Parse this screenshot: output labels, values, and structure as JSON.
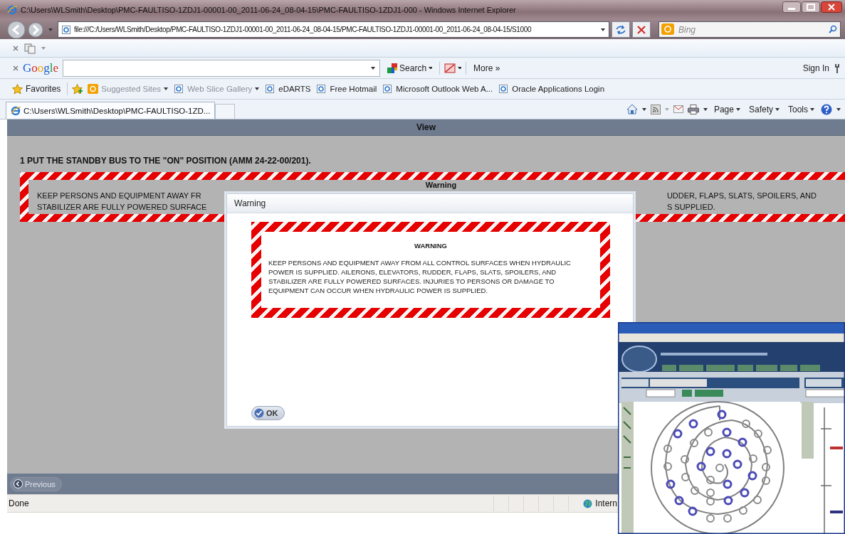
{
  "window": {
    "title": "C:\\Users\\WLSmith\\Desktop\\PMC-FAULTISO-1ZDJ1-00001-00_2011-06-24_08-04-15\\PMC-FAULTISO-1ZDJ1-000 - Windows Internet Explorer"
  },
  "address_bar": {
    "value": "file:///C:/Users/WLSmith/Desktop/PMC-FAULTISO-1ZDJ1-00001-00_2011-06-24_08-04-15/PMC-FAULTISO-1ZDJ1-00001-00_2011-06-24_08-04-15/S1000"
  },
  "search_box": {
    "placeholder": "Bing"
  },
  "google_bar": {
    "logo": "Google",
    "search_label": "Search",
    "more_label": "More »",
    "sign_in": "Sign In"
  },
  "favorites_button": "Favorites",
  "favorites": [
    {
      "label": "Suggested Sites",
      "kind": "feed",
      "dimmed": true,
      "has_menu": true
    },
    {
      "label": "Web Slice Gallery",
      "kind": "page",
      "dimmed": true,
      "has_menu": true
    },
    {
      "label": "eDARTS",
      "kind": "page",
      "dimmed": false,
      "has_menu": false
    },
    {
      "label": "Free Hotmail",
      "kind": "page",
      "dimmed": false,
      "has_menu": false
    },
    {
      "label": "Microsoft Outlook Web A...",
      "kind": "page",
      "dimmed": false,
      "has_menu": false
    },
    {
      "label": "Oracle Applications Login",
      "kind": "page",
      "dimmed": false,
      "has_menu": false
    }
  ],
  "tabs": [
    {
      "label": "C:\\Users\\WLSmith\\Desktop\\PMC-FAULTISO-1ZD...",
      "selected": true
    }
  ],
  "command_bar": [
    {
      "label": "Page"
    },
    {
      "label": "Safety"
    },
    {
      "label": "Tools"
    }
  ],
  "page": {
    "header": "View",
    "step": "1 PUT THE STANDBY BUS TO THE \"ON\" POSITION (AMM 24-22-00/201).",
    "banner": {
      "title": "Warning",
      "left_lines": [
        "KEEP PERSONS AND EQUIPMENT AWAY FR",
        "STABILIZER ARE FULLY POWERED SURFACE"
      ],
      "right_lines": [
        "UDDER, FLAPS, SLATS, SPOILERS, AND",
        "S SUPPLIED."
      ]
    },
    "previous_button": "Previous"
  },
  "dialog": {
    "title": "Warning",
    "heading": "WARNING",
    "body": "KEEP PERSONS AND EQUIPMENT AWAY FROM ALL CONTROL SURFACES WHEN HYDRAULIC POWER IS SUPPLIED. AILERONS, ELEVATORS, RUDDER, FLAPS, SLATS, SPOILERS, AND STABILIZER ARE FULLY POWERED SURFACES. INJURIES TO PERSONS OR DAMAGE TO EQUIPMENT CAN OCCUR WHEN HYDRAULIC POWER IS SUPPLIED.",
    "ok_button": "OK"
  },
  "status_bar": {
    "text": "Done",
    "zone": "Intern"
  }
}
